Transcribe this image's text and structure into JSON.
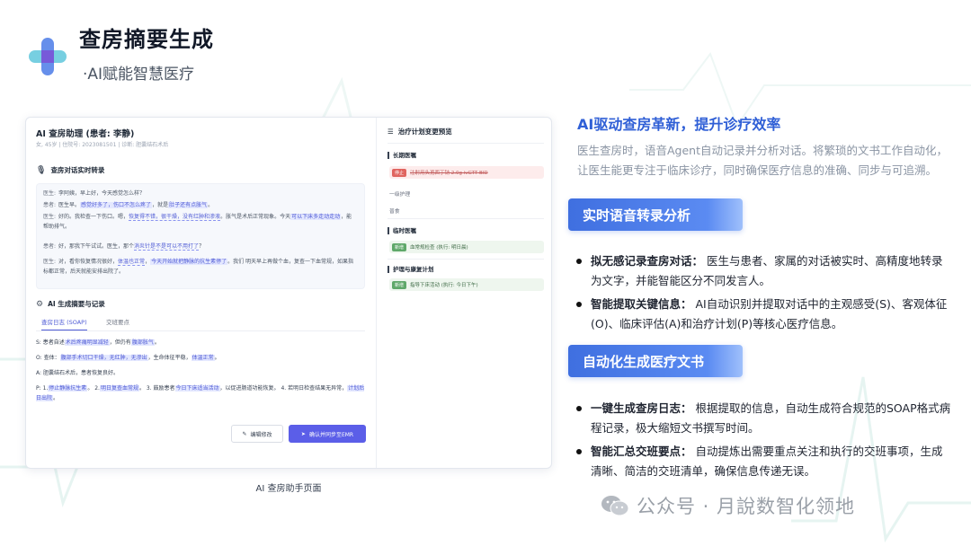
{
  "slide": {
    "title": "查房摘要生成",
    "subtitle": "·AI赋能智慧医疗",
    "caption": "AI 查房助手页面"
  },
  "app": {
    "title": "AI 查房助理 (患者: 李静)",
    "meta": "女, 45岁 | 住院号: 2023081501 | 诊断: 胆囊结石术后",
    "transcript_heading": "查房对话实时转录",
    "dialog": [
      {
        "speaker": "医生:",
        "text": "李阿姨，早上好，今天感觉怎么样？"
      },
      {
        "speaker": "患者:",
        "pre": "医生早。",
        "hl1": "感觉好多了，伤口不怎么疼了",
        "mid": "，就是",
        "hl2": "肚子还有点胀气",
        "post": "。"
      },
      {
        "speaker": "医生:",
        "pre": "好的。我检查一下伤口。嗯，",
        "hl1": "恢复得不错，很干燥，没有红肿和渗液",
        "mid": "。胀气是术后正常现象。今天",
        "hl2": "可以下床多走动走动",
        "post": "，能帮助排气。"
      },
      {
        "speaker": "患者:",
        "pre": "好，那我下午试试。医生，那个",
        "hl1": "消炎针是不是可以不用打了",
        "mid": "？",
        "hl2": "",
        "post": ""
      },
      {
        "speaker": "医生:",
        "pre": "对，看你恢复情况很好，",
        "hl1": "体温也正常",
        "mid": "，",
        "hl2": "今天开始就把静脉的抗生素停了",
        "post": "。我们 明天早上再做个血，复查一下血常规，如果指标都正常，后天就能安排出院了。"
      }
    ],
    "summary_heading": "AI 生成摘要与记录",
    "tabs": [
      "查房日志 (SOAP)",
      "交班要点"
    ],
    "soap": {
      "s": {
        "label": "S:",
        "pre": "患者自述",
        "hl1": "术后疼痛明显减轻",
        "mid": "，但仍有",
        "hl2": "腹部胀气",
        "post": "。"
      },
      "o": {
        "label": "O:",
        "pre": "查体：",
        "hl1": "腹部手术切口干燥，无红肿，无渗出",
        "mid": "，生命体征平稳，",
        "hl2": "体温正常",
        "post": "。"
      },
      "a": {
        "label": "A:",
        "text": "胆囊结石术后，患者恢复良好。"
      },
      "p": {
        "label": "P:",
        "p1": "1.",
        "hl1": "停止静脉抗生素",
        "t1": "。 2.",
        "hl2": "明日复查血常规",
        "t2": "。 3. 鼓励患者",
        "hl3": "今日下床适当活动",
        "t3": "，以促进肠道功能恢复。 4. 若明日检查结果无异常，",
        "hl4": "计划后日出院",
        "t4": "。"
      }
    },
    "edit_button": "编辑修改",
    "sync_button": "确认并同步至EMR",
    "plan": {
      "title": "治疗计划变更预览",
      "long_term": "长期医嘱",
      "long_term_item_tag": "停止",
      "long_term_item": "注射用头孢西丁钠 2.0g ivGTT BID",
      "nursing_level": "一级护理",
      "diet": "普食",
      "temp_orders": "临时医嘱",
      "temp_tag": "新增",
      "temp_item": "血常规检查 (执行: 明日晨)",
      "rehab": "护理与康复计划",
      "rehab_tag": "新增",
      "rehab_item": "指导下床活动 (执行: 今日下午)"
    }
  },
  "right": {
    "heading": "AI驱动查房革新，提升诊疗效率",
    "intro": "医生查房时，语音Agent自动记录并分析对话。将繁琐的文书工作自动化，让医生能更专注于临床诊疗，同时确保医疗信息的准确、同步与可追溯。",
    "section1": "实时语音转录分析",
    "bullets1": [
      {
        "bold": "拟无感记录查房对话：",
        "text": "医生与患者、家属的对话被实时、高精度地转录为文字，并能智能区分不同发言人。"
      },
      {
        "bold": "智能提取关键信息：",
        "text": "AI自动识别并提取对话中的主观感受(S)、客观体征(O)、临床评估(A)和治疗计划(P)等核心医疗信息。"
      }
    ],
    "section2": "自动化生成医疗文书",
    "bullets2": [
      {
        "bold": "一键生成查房日志：",
        "text": "根据提取的信息，自动生成符合规范的SOAP格式病程记录，极大缩短文书撰写时间。"
      },
      {
        "bold": "智能汇总交班要点：",
        "text": "自动提炼出需要重点关注和执行的交班事项，生成清晰、简洁的交班清单，确保信息传递无误。"
      }
    ]
  },
  "watermark": "公众号 · 月說数智化领地",
  "colors": {
    "accent": "#2f5fd6",
    "pill": "#3f6fe0",
    "highlight": "#4f5bd5",
    "button": "#5b5ee8"
  }
}
